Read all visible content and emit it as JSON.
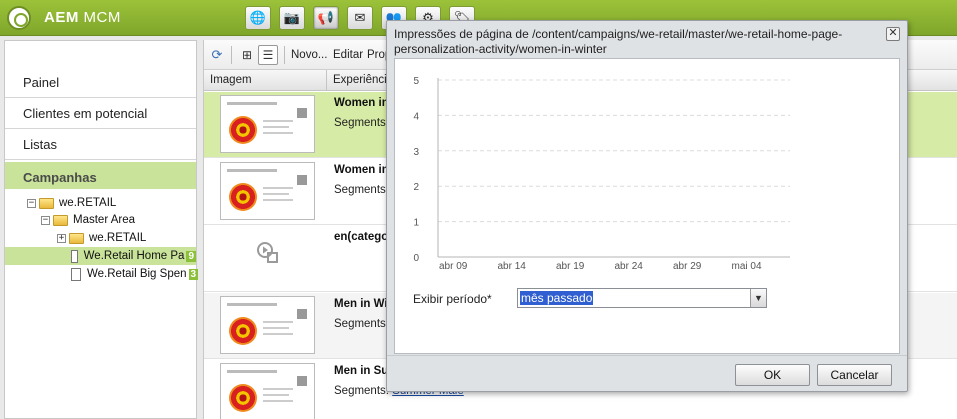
{
  "app": {
    "title_bold": "AEM",
    "title_rest": "MCM"
  },
  "toolbar_icons": [
    "globe-icon",
    "camera-icon",
    "campaign-icon",
    "mail-icon",
    "users-icon",
    "gear-icon",
    "tag-icon"
  ],
  "sidebar": {
    "items": [
      {
        "label": "Painel"
      },
      {
        "label": "Clientes em potencial"
      },
      {
        "label": "Listas"
      },
      {
        "label": "Campanhas"
      }
    ],
    "tree": [
      {
        "label": "we.RETAIL"
      },
      {
        "label": "Master Area"
      },
      {
        "label": "we.RETAIL"
      },
      {
        "label": "We.Retail Home Pa",
        "count": "9"
      },
      {
        "label": "We.Retail Big Spen",
        "count": "3"
      }
    ]
  },
  "grid": {
    "toolbar": {
      "new_label": "Novo...",
      "edit_label": "Editar",
      "props_label": "Prop"
    },
    "columns": {
      "image": "Imagem",
      "experience": "Experiência"
    },
    "rows": [
      {
        "title": "Women in",
        "segments_label": "Segments:",
        "segments_link": ""
      },
      {
        "title": "Women in",
        "segments_label": "Segments:",
        "segments_link": ""
      },
      {
        "title": "en(catego",
        "segments_label": "",
        "segments_link": ""
      },
      {
        "title": "Men in Wi",
        "segments_label": "Segments:",
        "segments_link": ""
      },
      {
        "title": "Men in Su",
        "segments_label": "Segments:",
        "segments_link": "Summer Male"
      }
    ]
  },
  "dialog": {
    "title": "Impressões de página de /content/campaigns/we-retail/master/we-retail-home-page-personalization-activity/women-in-winter",
    "period_label": "Exibir período*",
    "period_value": "mês passado",
    "ok_label": "OK",
    "cancel_label": "Cancelar"
  },
  "chart_data": {
    "type": "line",
    "x": [
      "abr 09",
      "abr 14",
      "abr 19",
      "abr 24",
      "abr 29",
      "mai 04"
    ],
    "series": [],
    "ylim": [
      0,
      5
    ],
    "yticks": [
      "0",
      "1",
      "2",
      "3",
      "4",
      "5"
    ],
    "grid": true
  }
}
